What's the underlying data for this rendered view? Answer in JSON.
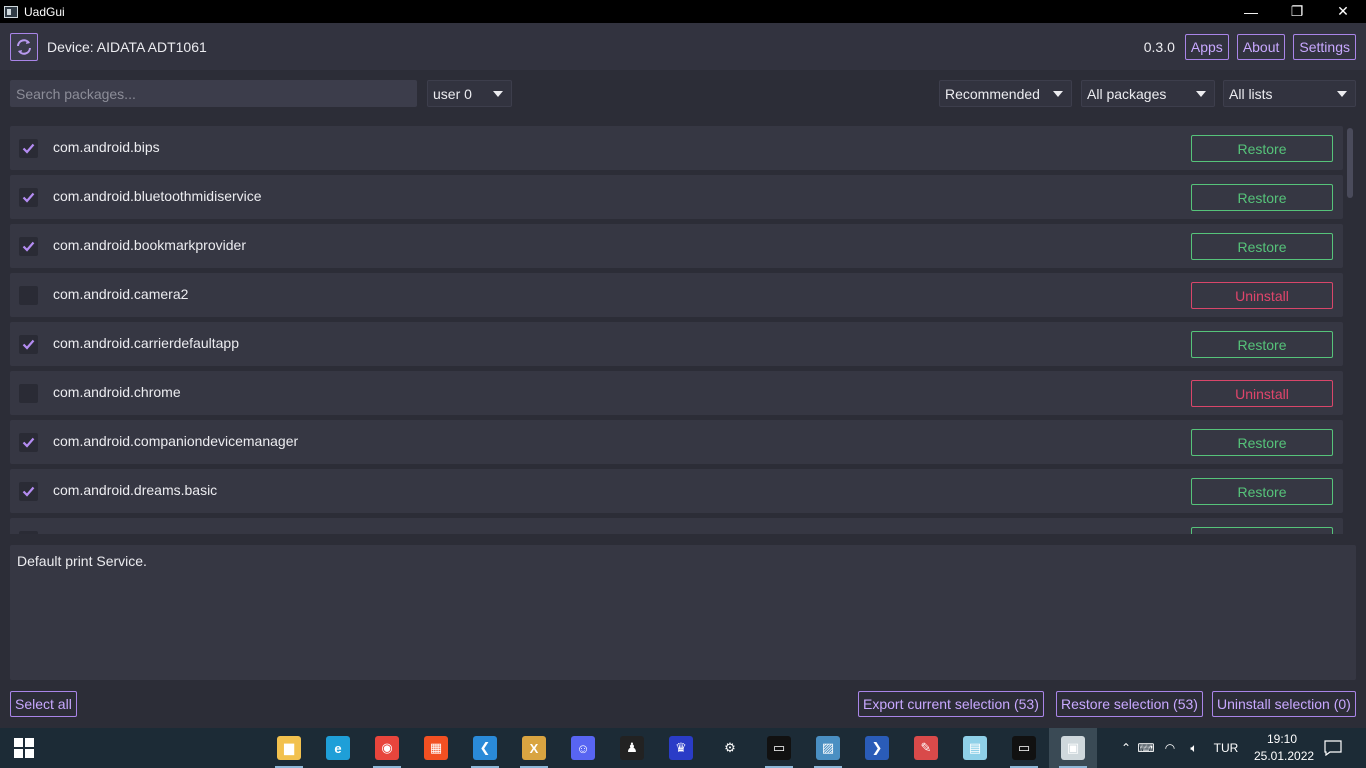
{
  "window": {
    "title": "UadGui",
    "controls": {
      "minimize": "—",
      "maximize": "❐",
      "close": "✕"
    }
  },
  "header": {
    "device": "Device: AIDATA ADT1061",
    "version": "0.3.0",
    "buttons": {
      "apps": "Apps",
      "about": "About",
      "settings": "Settings"
    }
  },
  "filters": {
    "search_placeholder": "Search packages...",
    "user": "user 0",
    "recommendation": "Recommended",
    "package_state": "All packages",
    "list": "All lists"
  },
  "packages": [
    {
      "name": "com.android.bips",
      "checked": true,
      "action": "Restore"
    },
    {
      "name": "com.android.bluetoothmidiservice",
      "checked": true,
      "action": "Restore"
    },
    {
      "name": "com.android.bookmarkprovider",
      "checked": true,
      "action": "Restore"
    },
    {
      "name": "com.android.camera2",
      "checked": false,
      "action": "Uninstall"
    },
    {
      "name": "com.android.carrierdefaultapp",
      "checked": true,
      "action": "Restore"
    },
    {
      "name": "com.android.chrome",
      "checked": false,
      "action": "Uninstall"
    },
    {
      "name": "com.android.companiondevicemanager",
      "checked": true,
      "action": "Restore"
    },
    {
      "name": "com.android.dreams.basic",
      "checked": true,
      "action": "Restore"
    },
    {
      "name": "",
      "checked": false,
      "action": ""
    }
  ],
  "description": "Default print Service.",
  "footer": {
    "select_all": "Select all",
    "export": "Export current selection (53)",
    "restore": "Restore selection (53)",
    "uninstall": "Uninstall selection (0)"
  },
  "taskbar": {
    "apps": [
      {
        "icon": "file-explorer-icon",
        "color": "#f2c14e"
      },
      {
        "icon": "edge-icon",
        "color": "#1f9fd8"
      },
      {
        "icon": "chrome-icon",
        "color": "#e8453c"
      },
      {
        "icon": "store-icon",
        "color": "#f25022"
      },
      {
        "icon": "vscode-icon",
        "color": "#2a8ad8"
      },
      {
        "icon": "excel-xd-icon",
        "color": "#d9a441"
      },
      {
        "icon": "discord-icon",
        "color": "#5865f2"
      },
      {
        "icon": "linux-penguin-icon",
        "color": "#222222"
      },
      {
        "icon": "crown-app-icon",
        "color": "#2a3cc7"
      },
      {
        "icon": "settings-gear-icon",
        "color": "#1c2b36"
      },
      {
        "icon": "terminal-icon",
        "color": "#111111"
      },
      {
        "icon": "photos-icon",
        "color": "#4a8fc2"
      },
      {
        "icon": "powershell-icon",
        "color": "#2a5cb8"
      },
      {
        "icon": "paint-icon",
        "color": "#d94a4a"
      },
      {
        "icon": "notes-icon",
        "color": "#8fd0e8"
      },
      {
        "icon": "console-icon",
        "color": "#111111"
      },
      {
        "icon": "uadgui-app-icon",
        "color": "#cfd8dc"
      }
    ],
    "tray": {
      "language": "TUR",
      "time": "19:10",
      "date": "25.01.2022"
    }
  },
  "colors": {
    "accent": "#a985e8",
    "restore": "#56c37a",
    "uninstall": "#e0456b",
    "background": "#2c2d37",
    "row": "#363743"
  }
}
